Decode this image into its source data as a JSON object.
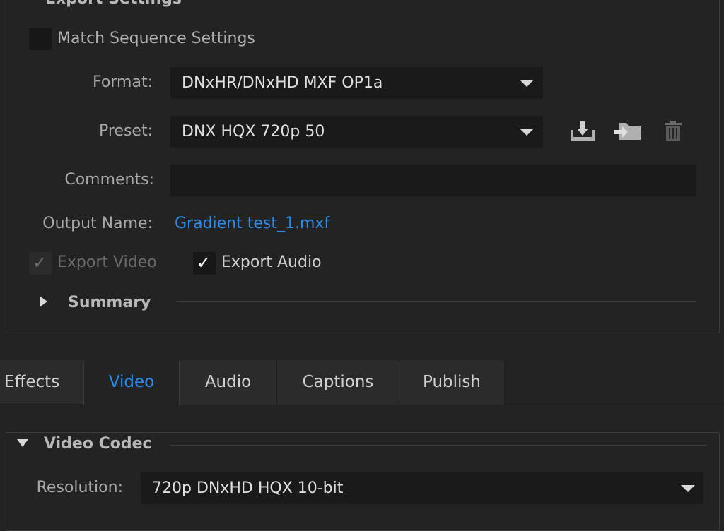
{
  "export_settings": {
    "title": "Export Settings",
    "match_sequence_label": "Match Sequence Settings",
    "format_label": "Format:",
    "format_value": "DNxHR/DNxHD MXF OP1a",
    "preset_label": "Preset:",
    "preset_value": "DNX HQX 720p 50",
    "comments_label": "Comments:",
    "comments_value": "",
    "output_name_label": "Output Name:",
    "output_name_value": "Gradient test_1.mxf",
    "export_video_label": "Export Video",
    "export_audio_label": "Export Audio",
    "summary_label": "Summary"
  },
  "tabs": [
    {
      "label": "Effects"
    },
    {
      "label": "Video"
    },
    {
      "label": "Audio"
    },
    {
      "label": "Captions"
    },
    {
      "label": "Publish"
    }
  ],
  "video_codec": {
    "title": "Video Codec",
    "resolution_label": "Resolution:",
    "resolution_value": "720p DNxHD HQX 10-bit"
  },
  "icons": {
    "save_preset": "save-preset-icon",
    "import_preset": "import-preset-icon",
    "delete_preset": "trash-icon"
  },
  "colors": {
    "background": "#232323",
    "field": "#1a1a1a",
    "accent": "#2d8ceb"
  }
}
